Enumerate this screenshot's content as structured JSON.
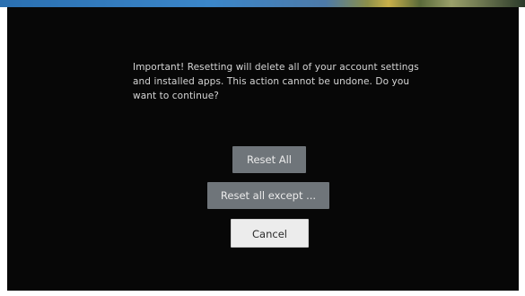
{
  "dialog": {
    "message": "Important! Resetting will delete all of your account settings and installed apps. This action cannot be undone. Do you want to continue?",
    "buttons": {
      "reset_all": "Reset All",
      "reset_all_except": "Reset all except ...",
      "cancel": "Cancel"
    },
    "focused_button": "cancel"
  },
  "colors": {
    "background": "#070707",
    "text": "#d6d6d6",
    "button_normal": "#6f757a",
    "button_focused": "#ececec"
  }
}
